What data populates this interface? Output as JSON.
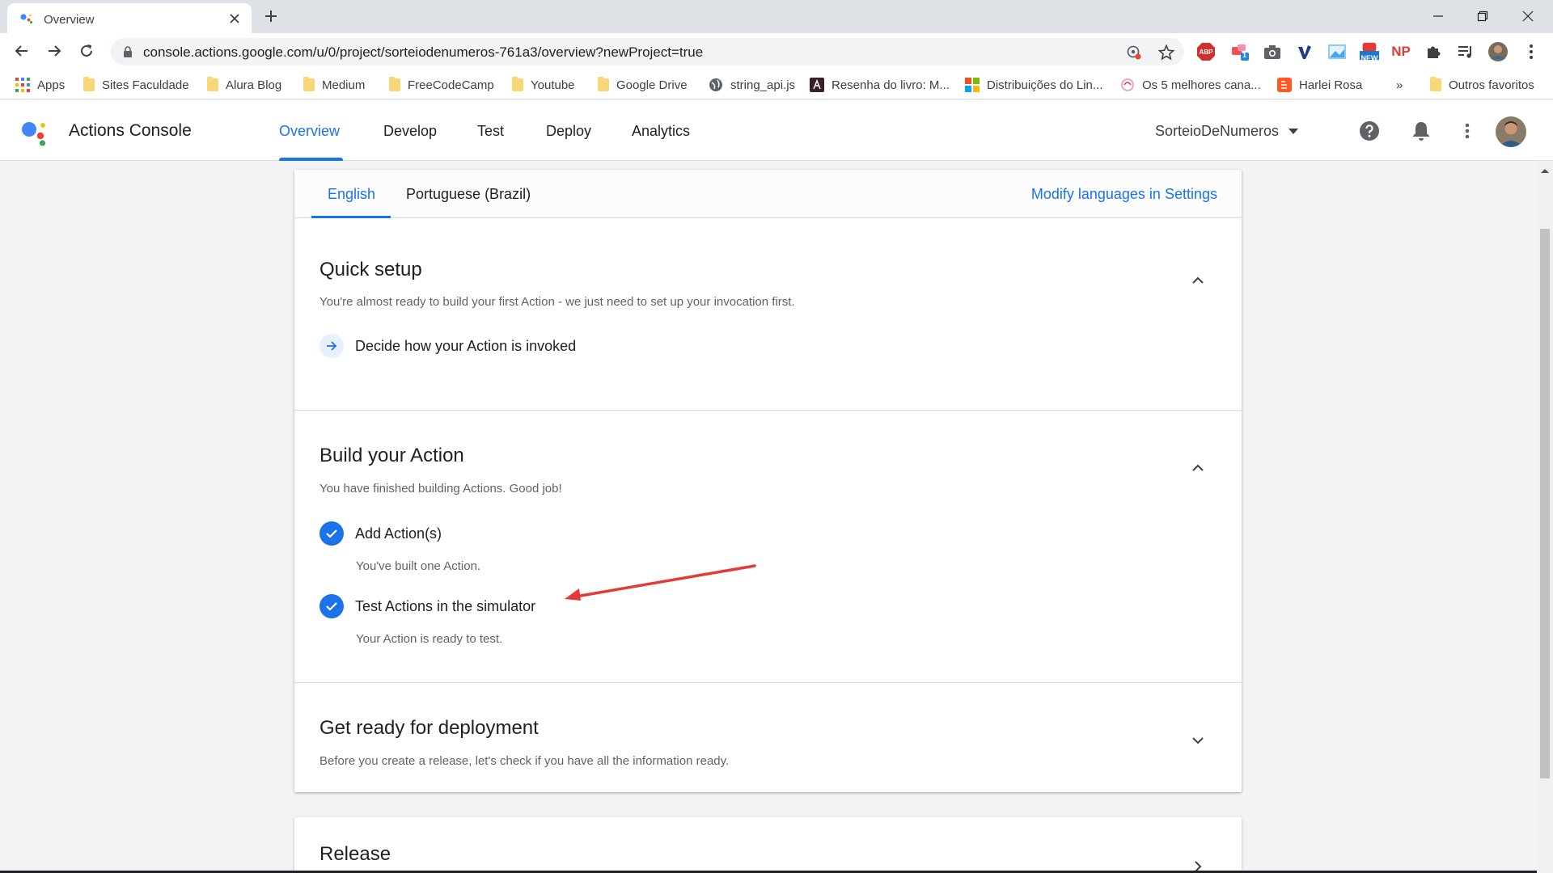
{
  "browser": {
    "tab_title": "Overview",
    "url": "console.actions.google.com/u/0/project/sorteiodenumeros-761a3/overview?newProject=true",
    "extension_badges": {
      "notification_count": "1",
      "new_label": "NEW",
      "np_label": "NP",
      "abp_label": "ABP"
    }
  },
  "bookmarks": [
    {
      "label": "Apps",
      "icon": "apps-grid-icon"
    },
    {
      "label": "Sites Faculdade",
      "icon": "folder-icon"
    },
    {
      "label": "Alura Blog",
      "icon": "folder-icon"
    },
    {
      "label": "Medium",
      "icon": "folder-icon"
    },
    {
      "label": "FreeCodeCamp",
      "icon": "folder-icon"
    },
    {
      "label": "Youtube",
      "icon": "folder-icon"
    },
    {
      "label": "Google Drive",
      "icon": "folder-icon"
    },
    {
      "label": "string_api.js",
      "icon": "globe-icon"
    },
    {
      "label": "Resenha do livro: M...",
      "icon": "site-icon"
    },
    {
      "label": "Distribuições do Lin...",
      "icon": "windows-icon"
    },
    {
      "label": "Os 5 melhores cana...",
      "icon": "site-icon"
    },
    {
      "label": "Harlei Rosa",
      "icon": "blogger-icon"
    }
  ],
  "bookmarks_overflow": "»",
  "bookmarks_other": "Outros favoritos",
  "app": {
    "title": "Actions Console",
    "nav": [
      "Overview",
      "Develop",
      "Test",
      "Deploy",
      "Analytics"
    ],
    "active_nav": "Overview",
    "project_name": "SorteioDeNumeros"
  },
  "languages": {
    "tabs": [
      "English",
      "Portuguese (Brazil)"
    ],
    "active": "English",
    "modify_link": "Modify languages in Settings"
  },
  "sections": {
    "quick_setup": {
      "title": "Quick setup",
      "subtitle": "You're almost ready to build your first Action - we just need to set up your invocation first.",
      "steps": [
        {
          "label": "Decide how your Action is invoked",
          "status": "pending"
        }
      ],
      "expanded": true
    },
    "build": {
      "title": "Build your Action",
      "subtitle": "You have finished building Actions. Good job!",
      "steps": [
        {
          "label": "Add Action(s)",
          "desc": "You've built one Action.",
          "status": "done"
        },
        {
          "label": "Test Actions in the simulator",
          "desc": "Your Action is ready to test.",
          "status": "done"
        }
      ],
      "expanded": true
    },
    "deploy": {
      "title": "Get ready for deployment",
      "subtitle": "Before you create a release, let's check if you have all the information ready.",
      "expanded": false
    },
    "release": {
      "title": "Release"
    }
  },
  "colors": {
    "accent": "#1a73e8",
    "annotation_arrow": "#e53935"
  }
}
